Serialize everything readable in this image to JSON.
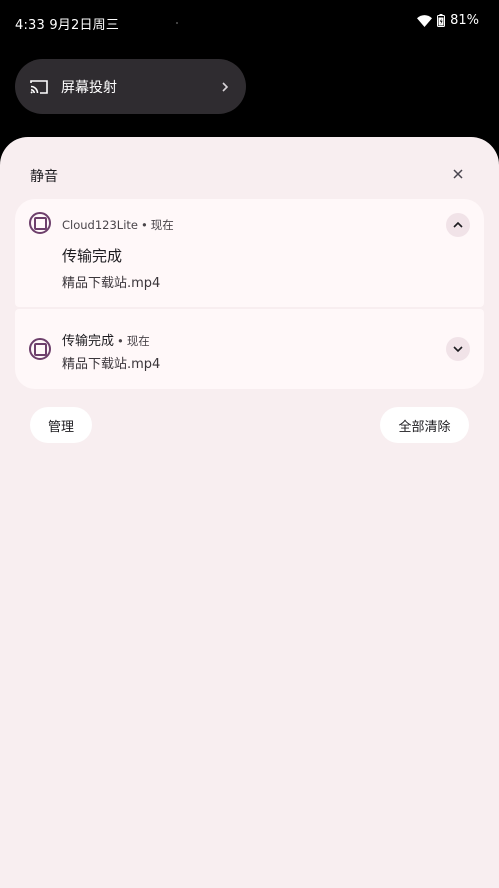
{
  "status_bar": {
    "time_date": "4:33 9月2日周三",
    "battery_percent": "81%",
    "icons": [
      "wifi-icon",
      "battery-icon"
    ]
  },
  "quick_settings": {
    "cast_tile": {
      "label": "屏幕投射",
      "icon": "cast-icon"
    }
  },
  "shade": {
    "section_title": "静音",
    "notifications": [
      {
        "app_name": "Cloud123Lite",
        "separator": "•",
        "time": "现在",
        "title": "传输完成",
        "body": "精品下载站.mp4",
        "expanded": true
      },
      {
        "title": "传输完成",
        "separator": "•",
        "time": "现在",
        "body": "精品下载站.mp4",
        "expanded": false
      }
    ],
    "manage_label": "管理",
    "clear_all_label": "全部清除"
  },
  "colors": {
    "shade_background": "#f8eef0",
    "card_background": "#fff8f9",
    "accent": "#6d3f6b",
    "tile_background": "#2f2c30"
  }
}
